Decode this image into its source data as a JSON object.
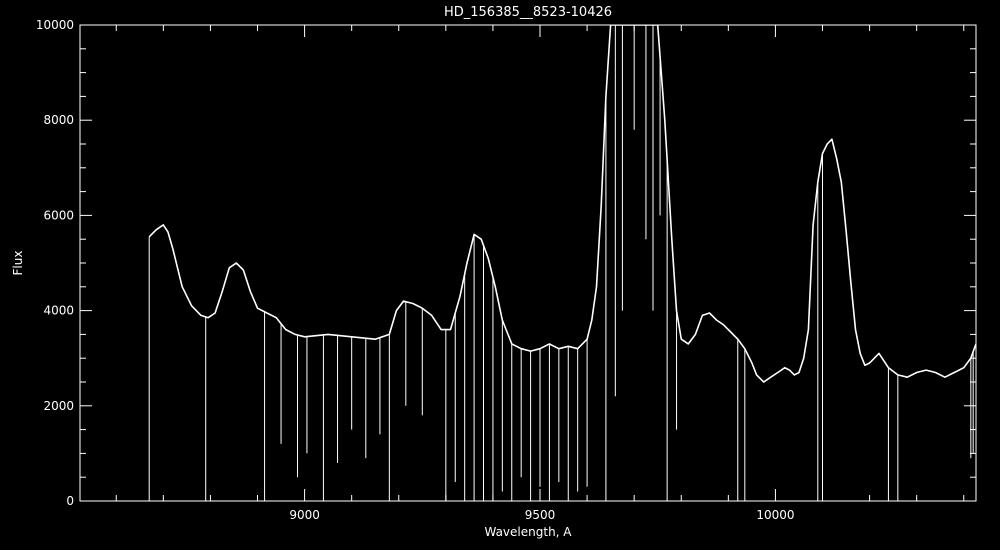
{
  "chart_data": {
    "type": "line",
    "title": "HD_156385__8523-10426",
    "xlabel": "Wavelength, A",
    "ylabel": "Flux",
    "xlim": [
      8523,
      10426
    ],
    "ylim": [
      0,
      10000
    ],
    "x_ticks": [
      9000,
      9500,
      10000
    ],
    "x_tick_labels": [
      "9000",
      "9500",
      "10000"
    ],
    "y_ticks": [
      0,
      2000,
      4000,
      6000,
      8000,
      10000
    ],
    "y_tick_labels": [
      "0",
      "2000",
      "4000",
      "6000",
      "8000",
      "10000"
    ],
    "grid": false,
    "background_color": "#000000",
    "line_color": "#ffffff",
    "series": [
      {
        "x": [
          8670,
          8685,
          8700,
          8710,
          8720,
          8730,
          8740,
          8760,
          8780,
          8795,
          8810,
          8825,
          8840,
          8855,
          8870,
          8885,
          8900,
          8920,
          8940,
          8960,
          8980,
          9000,
          9050,
          9100,
          9150,
          9180,
          9195,
          9210,
          9230,
          9250,
          9270,
          9290,
          9310,
          9330,
          9345,
          9360,
          9375,
          9390,
          9405,
          9420,
          9440,
          9460,
          9480,
          9500,
          9520,
          9540,
          9560,
          9580,
          9600,
          9610,
          9620,
          9630,
          9640,
          9650,
          9660,
          9670,
          9690,
          9710,
          9730,
          9750,
          9765,
          9780,
          9790,
          9800,
          9815,
          9830,
          9845,
          9860,
          9875,
          9890,
          9905,
          9920,
          9935,
          9950,
          9960,
          9975,
          9990,
          10005,
          10020,
          10030,
          10040,
          10050,
          10060,
          10070,
          10080,
          10090,
          10100,
          10110,
          10120,
          10130,
          10140,
          10150,
          10160,
          10170,
          10180,
          10190,
          10200,
          10210,
          10220,
          10240,
          10260,
          10280,
          10300,
          10320,
          10340,
          10360,
          10380,
          10400,
          10415,
          10426
        ],
        "y": [
          5550,
          5700,
          5800,
          5650,
          5300,
          4900,
          4500,
          4100,
          3900,
          3850,
          3950,
          4400,
          4900,
          5000,
          4850,
          4400,
          4050,
          3950,
          3850,
          3600,
          3500,
          3450,
          3500,
          3450,
          3400,
          3500,
          4000,
          4200,
          4150,
          4050,
          3900,
          3600,
          3600,
          4300,
          5000,
          5600,
          5500,
          5100,
          4500,
          3800,
          3300,
          3200,
          3150,
          3200,
          3300,
          3200,
          3250,
          3200,
          3400,
          3800,
          4500,
          6200,
          8500,
          10000,
          10000,
          10000,
          10000,
          10000,
          10000,
          10000,
          8000,
          5500,
          4000,
          3400,
          3300,
          3500,
          3900,
          3950,
          3800,
          3700,
          3550,
          3400,
          3200,
          2900,
          2650,
          2500,
          2600,
          2700,
          2800,
          2750,
          2650,
          2700,
          3000,
          3600,
          5800,
          6700,
          7300,
          7500,
          7600,
          7200,
          6700,
          5700,
          4600,
          3600,
          3100,
          2850,
          2900,
          3000,
          3100,
          2800,
          2650,
          2600,
          2700,
          2750,
          2700,
          2600,
          2700,
          2800,
          3000,
          3300
        ]
      }
    ],
    "absorption_dips": [
      {
        "x": 8670,
        "y": 0
      },
      {
        "x": 8790,
        "y": 0
      },
      {
        "x": 8915,
        "y": 0
      },
      {
        "x": 8950,
        "y": 1200
      },
      {
        "x": 8985,
        "y": 500
      },
      {
        "x": 9005,
        "y": 1000
      },
      {
        "x": 9040,
        "y": 0
      },
      {
        "x": 9070,
        "y": 800
      },
      {
        "x": 9100,
        "y": 1500
      },
      {
        "x": 9130,
        "y": 900
      },
      {
        "x": 9160,
        "y": 1400
      },
      {
        "x": 9180,
        "y": 0
      },
      {
        "x": 9215,
        "y": 2000
      },
      {
        "x": 9250,
        "y": 1800
      },
      {
        "x": 9300,
        "y": 0
      },
      {
        "x": 9320,
        "y": 400
      },
      {
        "x": 9340,
        "y": 0
      },
      {
        "x": 9360,
        "y": 0
      },
      {
        "x": 9380,
        "y": 0
      },
      {
        "x": 9400,
        "y": 0
      },
      {
        "x": 9420,
        "y": 200
      },
      {
        "x": 9440,
        "y": 0
      },
      {
        "x": 9460,
        "y": 500
      },
      {
        "x": 9480,
        "y": 0
      },
      {
        "x": 9500,
        "y": 300
      },
      {
        "x": 9520,
        "y": 0
      },
      {
        "x": 9540,
        "y": 400
      },
      {
        "x": 9560,
        "y": 0
      },
      {
        "x": 9580,
        "y": 200
      },
      {
        "x": 9600,
        "y": 300
      },
      {
        "x": 9640,
        "y": 0
      },
      {
        "x": 9660,
        "y": 2200
      },
      {
        "x": 9675,
        "y": 4000
      },
      {
        "x": 9700,
        "y": 7800
      },
      {
        "x": 9725,
        "y": 5500
      },
      {
        "x": 9740,
        "y": 4000
      },
      {
        "x": 9755,
        "y": 6000
      },
      {
        "x": 9770,
        "y": 0
      },
      {
        "x": 9790,
        "y": 1500
      },
      {
        "x": 9920,
        "y": 0
      },
      {
        "x": 9935,
        "y": 0
      },
      {
        "x": 10090,
        "y": 0
      },
      {
        "x": 10100,
        "y": 0
      },
      {
        "x": 10240,
        "y": 0
      },
      {
        "x": 10260,
        "y": 0
      },
      {
        "x": 10415,
        "y": 900
      },
      {
        "x": 10420,
        "y": 1000
      }
    ]
  }
}
